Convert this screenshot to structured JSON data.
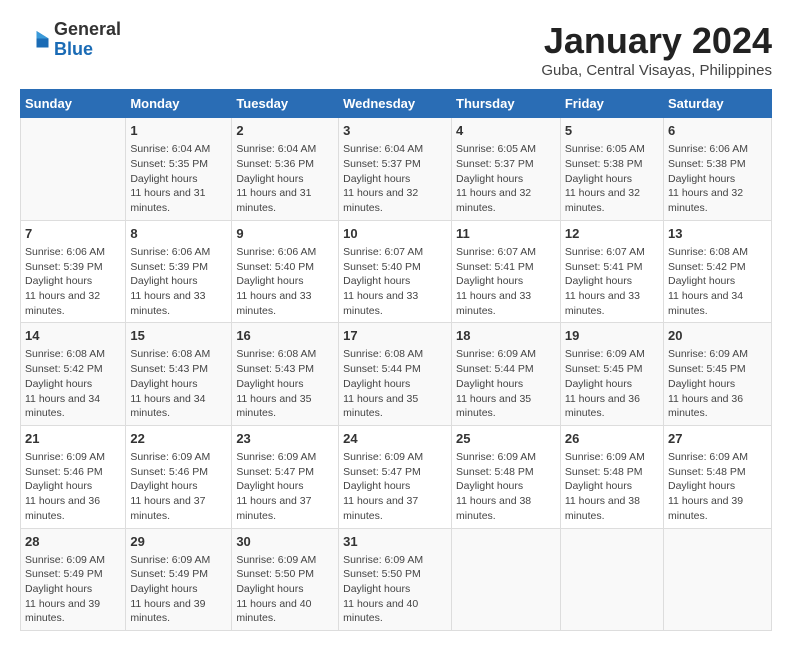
{
  "header": {
    "logo_general": "General",
    "logo_blue": "Blue",
    "month_title": "January 2024",
    "location": "Guba, Central Visayas, Philippines"
  },
  "days_of_week": [
    "Sunday",
    "Monday",
    "Tuesday",
    "Wednesday",
    "Thursday",
    "Friday",
    "Saturday"
  ],
  "weeks": [
    [
      {
        "day": "",
        "sunrise": "",
        "sunset": "",
        "daylight": ""
      },
      {
        "day": "1",
        "sunrise": "6:04 AM",
        "sunset": "5:35 PM",
        "daylight": "11 hours and 31 minutes."
      },
      {
        "day": "2",
        "sunrise": "6:04 AM",
        "sunset": "5:36 PM",
        "daylight": "11 hours and 31 minutes."
      },
      {
        "day": "3",
        "sunrise": "6:04 AM",
        "sunset": "5:37 PM",
        "daylight": "11 hours and 32 minutes."
      },
      {
        "day": "4",
        "sunrise": "6:05 AM",
        "sunset": "5:37 PM",
        "daylight": "11 hours and 32 minutes."
      },
      {
        "day": "5",
        "sunrise": "6:05 AM",
        "sunset": "5:38 PM",
        "daylight": "11 hours and 32 minutes."
      },
      {
        "day": "6",
        "sunrise": "6:06 AM",
        "sunset": "5:38 PM",
        "daylight": "11 hours and 32 minutes."
      }
    ],
    [
      {
        "day": "7",
        "sunrise": "6:06 AM",
        "sunset": "5:39 PM",
        "daylight": "11 hours and 32 minutes."
      },
      {
        "day": "8",
        "sunrise": "6:06 AM",
        "sunset": "5:39 PM",
        "daylight": "11 hours and 33 minutes."
      },
      {
        "day": "9",
        "sunrise": "6:06 AM",
        "sunset": "5:40 PM",
        "daylight": "11 hours and 33 minutes."
      },
      {
        "day": "10",
        "sunrise": "6:07 AM",
        "sunset": "5:40 PM",
        "daylight": "11 hours and 33 minutes."
      },
      {
        "day": "11",
        "sunrise": "6:07 AM",
        "sunset": "5:41 PM",
        "daylight": "11 hours and 33 minutes."
      },
      {
        "day": "12",
        "sunrise": "6:07 AM",
        "sunset": "5:41 PM",
        "daylight": "11 hours and 33 minutes."
      },
      {
        "day": "13",
        "sunrise": "6:08 AM",
        "sunset": "5:42 PM",
        "daylight": "11 hours and 34 minutes."
      }
    ],
    [
      {
        "day": "14",
        "sunrise": "6:08 AM",
        "sunset": "5:42 PM",
        "daylight": "11 hours and 34 minutes."
      },
      {
        "day": "15",
        "sunrise": "6:08 AM",
        "sunset": "5:43 PM",
        "daylight": "11 hours and 34 minutes."
      },
      {
        "day": "16",
        "sunrise": "6:08 AM",
        "sunset": "5:43 PM",
        "daylight": "11 hours and 35 minutes."
      },
      {
        "day": "17",
        "sunrise": "6:08 AM",
        "sunset": "5:44 PM",
        "daylight": "11 hours and 35 minutes."
      },
      {
        "day": "18",
        "sunrise": "6:09 AM",
        "sunset": "5:44 PM",
        "daylight": "11 hours and 35 minutes."
      },
      {
        "day": "19",
        "sunrise": "6:09 AM",
        "sunset": "5:45 PM",
        "daylight": "11 hours and 36 minutes."
      },
      {
        "day": "20",
        "sunrise": "6:09 AM",
        "sunset": "5:45 PM",
        "daylight": "11 hours and 36 minutes."
      }
    ],
    [
      {
        "day": "21",
        "sunrise": "6:09 AM",
        "sunset": "5:46 PM",
        "daylight": "11 hours and 36 minutes."
      },
      {
        "day": "22",
        "sunrise": "6:09 AM",
        "sunset": "5:46 PM",
        "daylight": "11 hours and 37 minutes."
      },
      {
        "day": "23",
        "sunrise": "6:09 AM",
        "sunset": "5:47 PM",
        "daylight": "11 hours and 37 minutes."
      },
      {
        "day": "24",
        "sunrise": "6:09 AM",
        "sunset": "5:47 PM",
        "daylight": "11 hours and 37 minutes."
      },
      {
        "day": "25",
        "sunrise": "6:09 AM",
        "sunset": "5:48 PM",
        "daylight": "11 hours and 38 minutes."
      },
      {
        "day": "26",
        "sunrise": "6:09 AM",
        "sunset": "5:48 PM",
        "daylight": "11 hours and 38 minutes."
      },
      {
        "day": "27",
        "sunrise": "6:09 AM",
        "sunset": "5:48 PM",
        "daylight": "11 hours and 39 minutes."
      }
    ],
    [
      {
        "day": "28",
        "sunrise": "6:09 AM",
        "sunset": "5:49 PM",
        "daylight": "11 hours and 39 minutes."
      },
      {
        "day": "29",
        "sunrise": "6:09 AM",
        "sunset": "5:49 PM",
        "daylight": "11 hours and 39 minutes."
      },
      {
        "day": "30",
        "sunrise": "6:09 AM",
        "sunset": "5:50 PM",
        "daylight": "11 hours and 40 minutes."
      },
      {
        "day": "31",
        "sunrise": "6:09 AM",
        "sunset": "5:50 PM",
        "daylight": "11 hours and 40 minutes."
      },
      {
        "day": "",
        "sunrise": "",
        "sunset": "",
        "daylight": ""
      },
      {
        "day": "",
        "sunrise": "",
        "sunset": "",
        "daylight": ""
      },
      {
        "day": "",
        "sunrise": "",
        "sunset": "",
        "daylight": ""
      }
    ]
  ]
}
